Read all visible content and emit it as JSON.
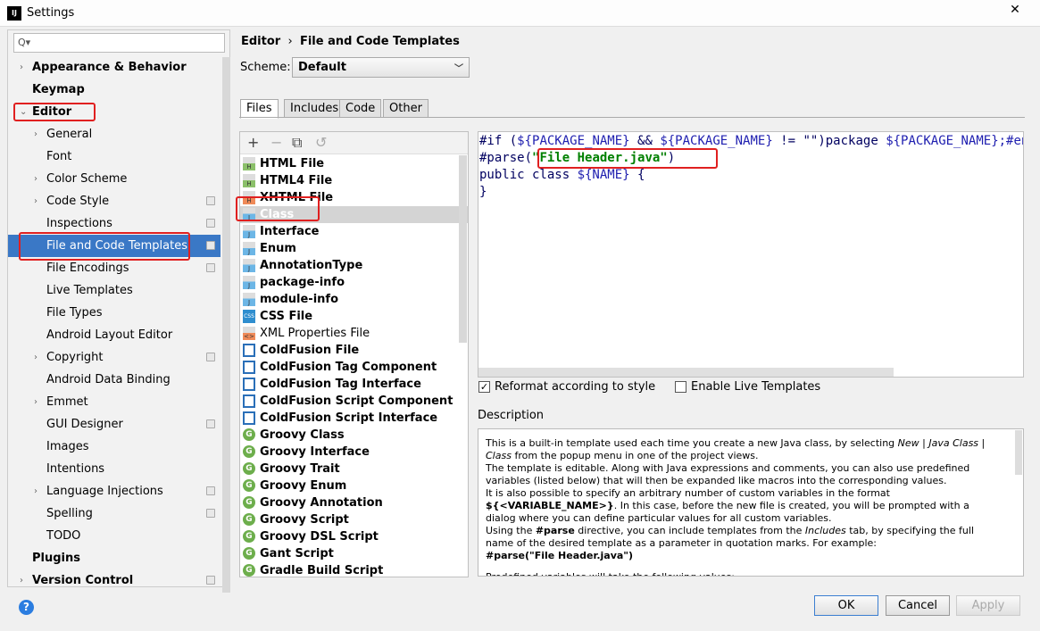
{
  "window": {
    "title": "Settings",
    "app_icon": "IJ",
    "close": "✕"
  },
  "sidebar": {
    "search_placeholder": "Q▾",
    "items": [
      {
        "label": "Appearance & Behavior",
        "bold": true,
        "arrow": "›",
        "level": 0
      },
      {
        "label": "Keymap",
        "bold": true,
        "level": 0
      },
      {
        "label": "Editor",
        "bold": true,
        "arrow": "⌄",
        "level": 0
      },
      {
        "label": "General",
        "arrow": "›",
        "level": 1
      },
      {
        "label": "Font",
        "level": 1
      },
      {
        "label": "Color Scheme",
        "arrow": "›",
        "level": 1
      },
      {
        "label": "Code Style",
        "arrow": "›",
        "level": 1,
        "copy": true
      },
      {
        "label": "Inspections",
        "level": 1,
        "copy": true
      },
      {
        "label": "File and Code Templates",
        "level": 1,
        "copy": true,
        "selected": true
      },
      {
        "label": "File Encodings",
        "level": 1,
        "copy": true
      },
      {
        "label": "Live Templates",
        "level": 1
      },
      {
        "label": "File Types",
        "level": 1
      },
      {
        "label": "Android Layout Editor",
        "level": 1
      },
      {
        "label": "Copyright",
        "arrow": "›",
        "level": 1,
        "copy": true
      },
      {
        "label": "Android Data Binding",
        "level": 1
      },
      {
        "label": "Emmet",
        "arrow": "›",
        "level": 1
      },
      {
        "label": "GUI Designer",
        "level": 1,
        "copy": true
      },
      {
        "label": "Images",
        "level": 1
      },
      {
        "label": "Intentions",
        "level": 1
      },
      {
        "label": "Language Injections",
        "arrow": "›",
        "level": 1,
        "copy": true
      },
      {
        "label": "Spelling",
        "level": 1,
        "copy": true
      },
      {
        "label": "TODO",
        "level": 1
      },
      {
        "label": "Plugins",
        "bold": true,
        "level": 0
      },
      {
        "label": "Version Control",
        "bold": true,
        "arrow": "›",
        "level": 0,
        "copy": true
      }
    ]
  },
  "breadcrumb": {
    "parent": "Editor",
    "sep": "›",
    "current": "File and Code Templates"
  },
  "scheme": {
    "label": "Scheme:",
    "value": "Default"
  },
  "tabs": [
    "Files",
    "Includes",
    "Code",
    "Other"
  ],
  "active_tab": "Files",
  "toolbar": {
    "add": "+",
    "remove": "−",
    "copy": "⧉",
    "reset": "↺"
  },
  "templates": [
    {
      "name": "HTML File",
      "icon": "h",
      "label": "H"
    },
    {
      "name": "HTML4 File",
      "icon": "h",
      "label": "H"
    },
    {
      "name": "XHTML File",
      "icon": "x",
      "label": "H"
    },
    {
      "name": "Class",
      "icon": "j",
      "label": "J",
      "selected": true
    },
    {
      "name": "Interface",
      "icon": "j",
      "label": "J"
    },
    {
      "name": "Enum",
      "icon": "j",
      "label": "J"
    },
    {
      "name": "AnnotationType",
      "icon": "j",
      "label": "J"
    },
    {
      "name": "package-info",
      "icon": "j",
      "label": "J"
    },
    {
      "name": "module-info",
      "icon": "j",
      "label": "J"
    },
    {
      "name": "CSS File",
      "icon": "css",
      "label": "CSS"
    },
    {
      "name": "XML Properties File",
      "icon": "x",
      "label": "<>",
      "regular": true
    },
    {
      "name": "ColdFusion File",
      "icon": "cf",
      "label": ""
    },
    {
      "name": "ColdFusion Tag Component",
      "icon": "cf",
      "label": ""
    },
    {
      "name": "ColdFusion Tag Interface",
      "icon": "cf",
      "label": ""
    },
    {
      "name": "ColdFusion Script Component",
      "icon": "cf",
      "label": ""
    },
    {
      "name": "ColdFusion Script Interface",
      "icon": "cf",
      "label": ""
    },
    {
      "name": "Groovy Class",
      "icon": "g",
      "label": "G"
    },
    {
      "name": "Groovy Interface",
      "icon": "g",
      "label": "G"
    },
    {
      "name": "Groovy Trait",
      "icon": "g",
      "label": "G"
    },
    {
      "name": "Groovy Enum",
      "icon": "g",
      "label": "G"
    },
    {
      "name": "Groovy Annotation",
      "icon": "g",
      "label": "G"
    },
    {
      "name": "Groovy Script",
      "icon": "g",
      "label": "G"
    },
    {
      "name": "Groovy DSL Script",
      "icon": "g",
      "label": "G"
    },
    {
      "name": "Gant Script",
      "icon": "g",
      "label": "G"
    },
    {
      "name": "Gradle Build Script",
      "icon": "g",
      "label": "G"
    }
  ],
  "editor": {
    "lines": [
      [
        [
          "kw",
          "#if ("
        ],
        [
          "var",
          "${PACKAGE_NAME}"
        ],
        [
          "kw",
          " && "
        ],
        [
          "var",
          "${PACKAGE_NAME}"
        ],
        [
          "kw",
          " != \"\")package "
        ],
        [
          "var",
          "${PACKAGE_NAME};#end"
        ]
      ],
      [
        [
          "kw",
          "#parse("
        ],
        [
          "str",
          "\"File Header.java\""
        ],
        [
          "kw",
          ")"
        ]
      ],
      [
        [
          "kw",
          "public class "
        ],
        [
          "var",
          "${NAME}"
        ],
        [
          "kw",
          " {"
        ]
      ],
      [
        [
          "kw",
          "}"
        ]
      ]
    ]
  },
  "options": {
    "reformat": {
      "label": "Reformat according to style",
      "checked": true
    },
    "live_templates": {
      "label": "Enable Live Templates",
      "checked": false
    }
  },
  "description": {
    "label": "Description",
    "html": "<p>This is a built-in template used each time you create a new Java class, by selecting <i>New</i> | <i>Java Class</i> | <i>Class</i> from the popup menu in one of the project views.</p><p>The template is editable. Along with Java expressions and comments, you can also use predefined variables (listed below) that will then be expanded like macros into the corresponding values.</p><p>It is also possible to specify an arbitrary number of custom variables in the format <b>${&lt;VARIABLE_NAME&gt;}</b>. In this case, before the new file is created, you will be prompted with a dialog where you can define particular values for all custom variables.</p><p>Using the <b>#parse</b> directive, you can include templates from the <i>Includes</i> tab, by specifying the full name of the desired template as a parameter in quotation marks. For example:</p><p><b>#parse(\"File Header.java\")</b></p><p style=\"margin-top:10px\">Predefined variables will take the following values:</p>"
  },
  "buttons": {
    "ok": "OK",
    "cancel": "Cancel",
    "apply": "Apply",
    "help": "?"
  },
  "colors": {
    "selection": "#3a78c6",
    "highlight": "#e02020"
  }
}
